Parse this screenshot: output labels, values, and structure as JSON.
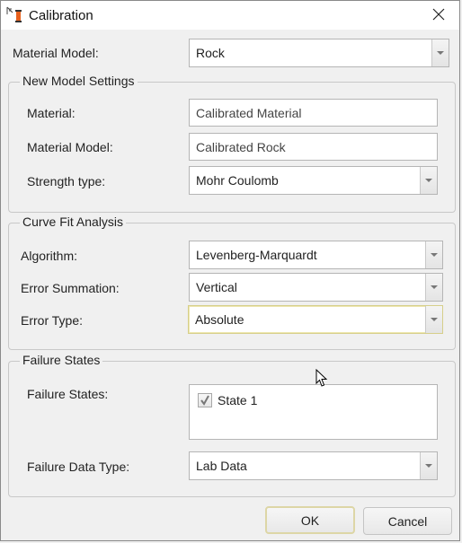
{
  "window": {
    "title": "Calibration",
    "icon": "calibration-app-icon",
    "close_icon": "close-icon"
  },
  "top": {
    "material_model_label": "Material Model:",
    "material_model_value": "Rock"
  },
  "new_model_settings": {
    "title": "New Model Settings",
    "material_label": "Material:",
    "material_value": "Calibrated Material",
    "material_model_label": "Material Model:",
    "material_model_value": "Calibrated Rock",
    "strength_type_label": "Strength type:",
    "strength_type_value": "Mohr Coulomb"
  },
  "curve_fit_analysis": {
    "title": "Curve Fit Analysis",
    "algorithm_label": "Algorithm:",
    "algorithm_value": "Levenberg-Marquardt",
    "error_summation_label": "Error Summation:",
    "error_summation_value": "Vertical",
    "error_type_label": "Error Type:",
    "error_type_value": "Absolute"
  },
  "failure_states": {
    "title": "Failure States",
    "states_label": "Failure States:",
    "states": [
      {
        "label": "State 1",
        "checked": true
      }
    ],
    "data_type_label": "Failure Data Type:",
    "data_type_value": "Lab Data"
  },
  "buttons": {
    "ok": "OK",
    "cancel": "Cancel"
  },
  "colors": {
    "focus_border": "#d6cf8a",
    "icon_orange": "#e8601c"
  }
}
